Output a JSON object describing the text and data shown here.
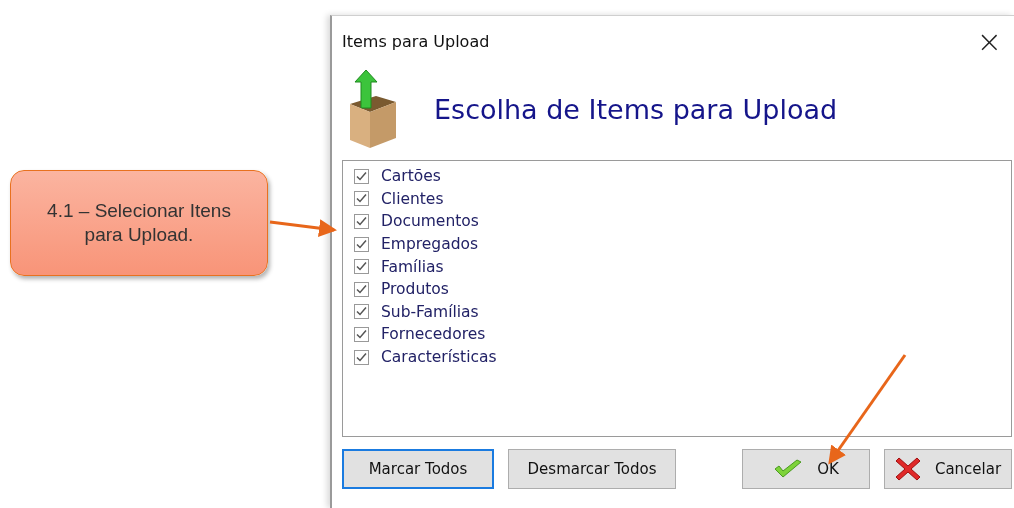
{
  "callout": {
    "text": "4.1 – Selecionar Itens para Upload."
  },
  "window": {
    "title": "Items para Upload",
    "close": "×"
  },
  "header": {
    "heading": "Escolha de Items para Upload"
  },
  "items": [
    {
      "label": "Cartões",
      "checked": true
    },
    {
      "label": "Clientes",
      "checked": true
    },
    {
      "label": "Documentos",
      "checked": true
    },
    {
      "label": "Empregados",
      "checked": true
    },
    {
      "label": "Famílias",
      "checked": true
    },
    {
      "label": "Produtos",
      "checked": true
    },
    {
      "label": "Sub-Famílias",
      "checked": true
    },
    {
      "label": "Fornecedores",
      "checked": true
    },
    {
      "label": "Características",
      "checked": true
    }
  ],
  "buttons": [
    {
      "label": "Marcar Todos",
      "kind": "plain",
      "focused": true
    },
    {
      "label": "Desmarcar Todos",
      "kind": "plain",
      "focused": false
    },
    {
      "label": "OK",
      "kind": "ok",
      "focused": false
    },
    {
      "label": "Cancelar",
      "kind": "cancel",
      "focused": false
    }
  ]
}
